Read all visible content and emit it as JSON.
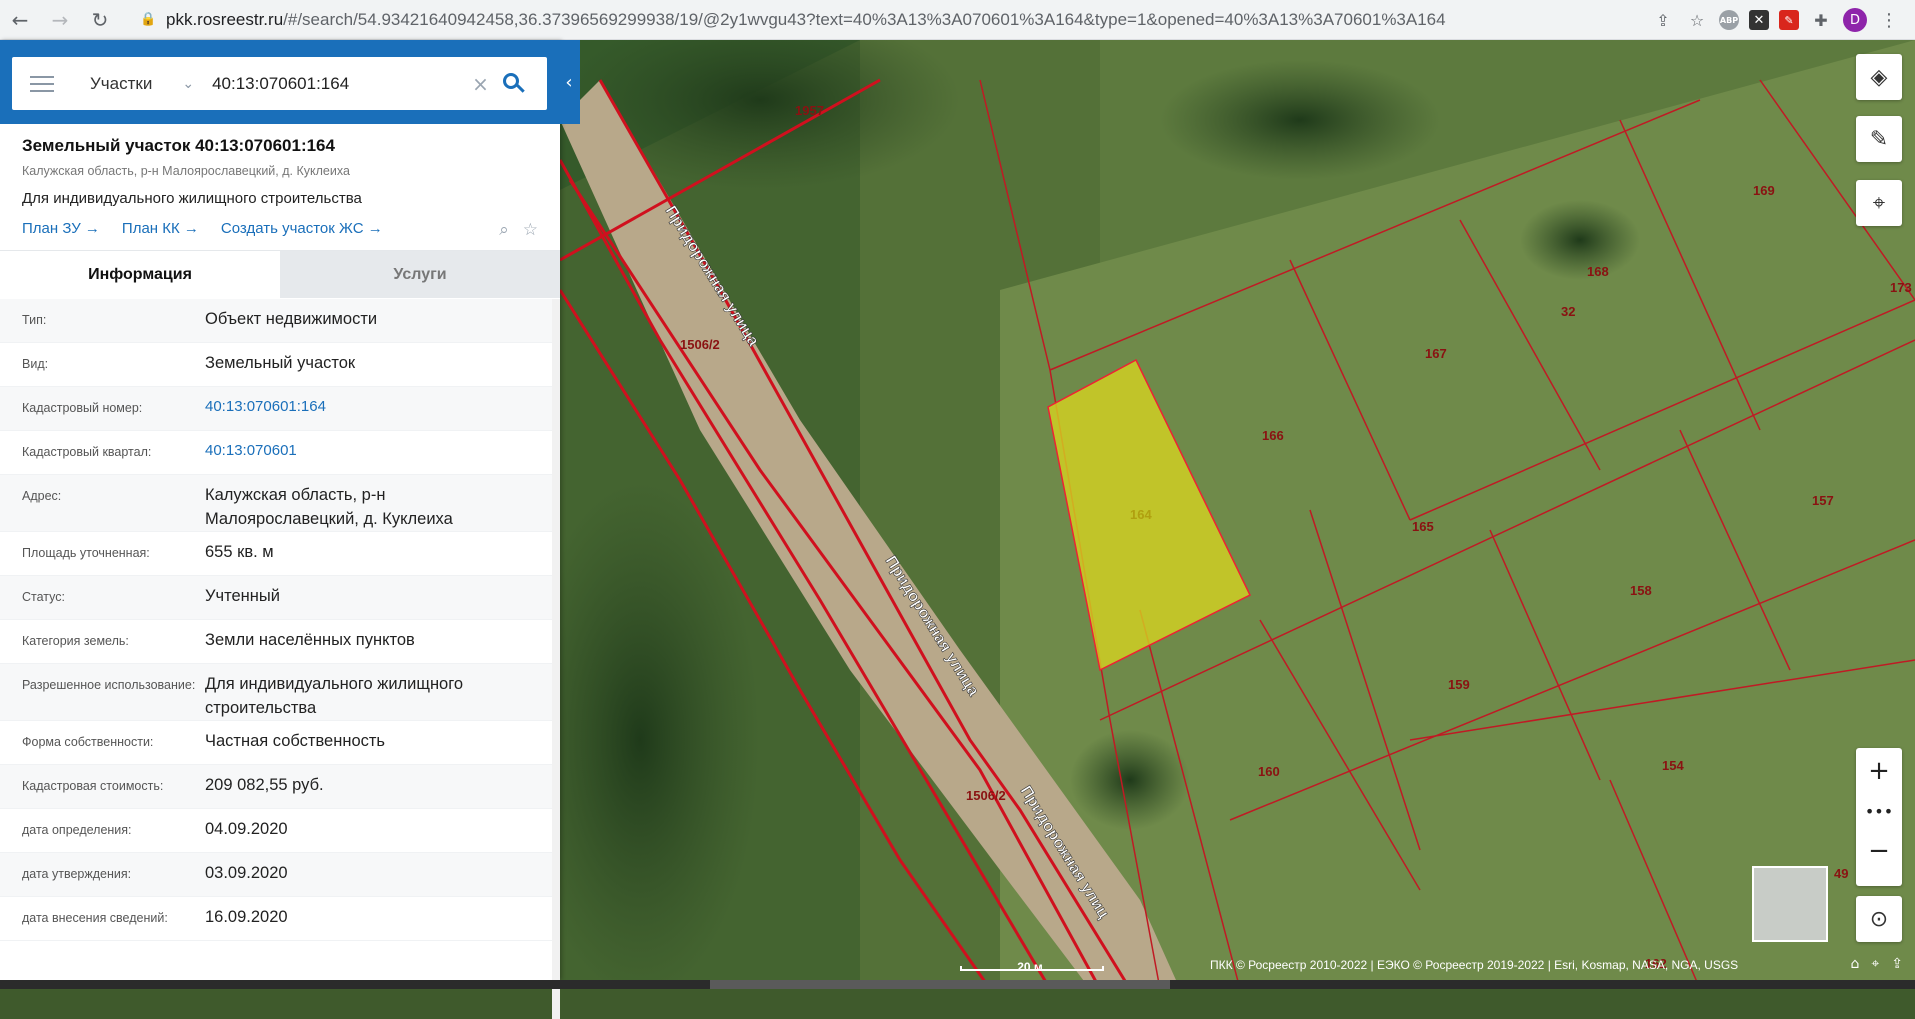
{
  "browser": {
    "url_host": "pkk.rosreestr.ru",
    "url_rest": "/#/search/54.93421640942458,36.37396569299938/19/@2y1wvgu43?text=40%3A13%3A070601%3A164&type=1&opened=40%3A13%3A70601%3A164",
    "avatar_letter": "D",
    "abp_label": "ABP"
  },
  "search": {
    "type_label": "Участки",
    "query": "40:13:070601:164"
  },
  "object": {
    "title": "Земельный участок 40:13:070601:164",
    "address": "Калужская область, р-н Малоярославецкий, д. Куклеиха",
    "use": "Для индивидуального жилищного строительства",
    "links": [
      "План ЗУ →",
      "План КК →",
      "Создать участок ЖС →"
    ]
  },
  "tabs": [
    "Информация",
    "Услуги"
  ],
  "rows": [
    {
      "label": "Тип:",
      "value": "Объект недвижимости"
    },
    {
      "label": "Вид:",
      "value": "Земельный участок"
    },
    {
      "label": "Кадастровый номер:",
      "value": "40:13:070601:164"
    },
    {
      "label": "Кадастровый квартал:",
      "value": "40:13:070601"
    },
    {
      "label": "Адрес:",
      "value": "Калужская область, р-н Малоярославецкий, д. Куклеиха"
    },
    {
      "label": "Площадь уточненная:",
      "value": "655 кв. м"
    },
    {
      "label": "Статус:",
      "value": "Учтенный"
    },
    {
      "label": "Категория земель:",
      "value": "Земли населённых пунктов"
    },
    {
      "label": "Разрешенное использование:",
      "value": "Для индивидуального жилищного строительства"
    },
    {
      "label": "Форма собственности:",
      "value": "Частная собственность"
    },
    {
      "label": "Кадастровая стоимость:",
      "value": "209 082,55 руб."
    },
    {
      "label": "дата определения:",
      "value": "04.09.2020"
    },
    {
      "label": "дата утверждения:",
      "value": "03.09.2020"
    },
    {
      "label": "дата внесения сведений:",
      "value": "16.09.2020"
    }
  ],
  "map": {
    "parcel_labels": [
      "1957",
      "1506/2",
      "164",
      "166",
      "165",
      "167",
      "168",
      "32",
      "169",
      "173",
      "157",
      "158",
      "159",
      "160",
      "154",
      "1506/2",
      "49",
      "162"
    ],
    "street_labels": [
      "Придорожная улица",
      "Придорожная улица",
      "Придорожная улиц"
    ],
    "scale": "20 м",
    "attribution": "ПКК © Росреестр 2010-2022 | ЕЭКО © Росреестр 2019-2022 | Esri, Kosmap, NASA, NGA, USGS"
  }
}
